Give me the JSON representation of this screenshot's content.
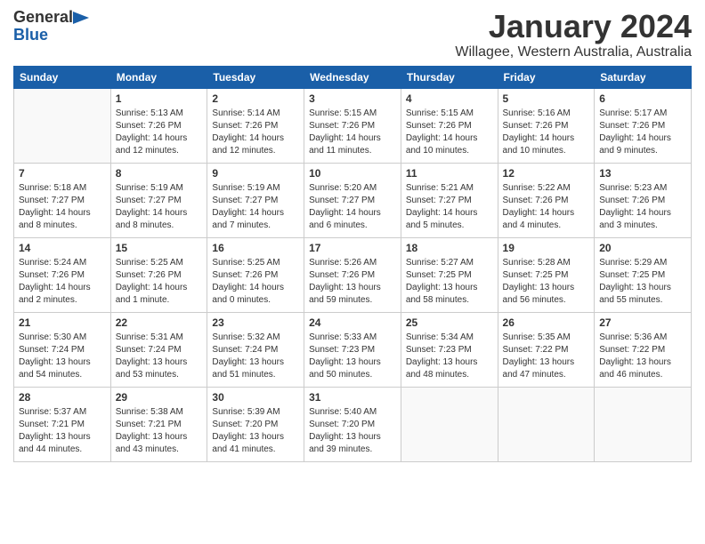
{
  "header": {
    "logo_line1": "General",
    "logo_line2": "Blue",
    "month_title": "January 2024",
    "location": "Willagee, Western Australia, Australia"
  },
  "weekdays": [
    "Sunday",
    "Monday",
    "Tuesday",
    "Wednesday",
    "Thursday",
    "Friday",
    "Saturday"
  ],
  "weeks": [
    [
      {
        "day": "",
        "info": ""
      },
      {
        "day": "1",
        "info": "Sunrise: 5:13 AM\nSunset: 7:26 PM\nDaylight: 14 hours\nand 12 minutes."
      },
      {
        "day": "2",
        "info": "Sunrise: 5:14 AM\nSunset: 7:26 PM\nDaylight: 14 hours\nand 12 minutes."
      },
      {
        "day": "3",
        "info": "Sunrise: 5:15 AM\nSunset: 7:26 PM\nDaylight: 14 hours\nand 11 minutes."
      },
      {
        "day": "4",
        "info": "Sunrise: 5:15 AM\nSunset: 7:26 PM\nDaylight: 14 hours\nand 10 minutes."
      },
      {
        "day": "5",
        "info": "Sunrise: 5:16 AM\nSunset: 7:26 PM\nDaylight: 14 hours\nand 10 minutes."
      },
      {
        "day": "6",
        "info": "Sunrise: 5:17 AM\nSunset: 7:26 PM\nDaylight: 14 hours\nand 9 minutes."
      }
    ],
    [
      {
        "day": "7",
        "info": "Sunrise: 5:18 AM\nSunset: 7:27 PM\nDaylight: 14 hours\nand 8 minutes."
      },
      {
        "day": "8",
        "info": "Sunrise: 5:19 AM\nSunset: 7:27 PM\nDaylight: 14 hours\nand 8 minutes."
      },
      {
        "day": "9",
        "info": "Sunrise: 5:19 AM\nSunset: 7:27 PM\nDaylight: 14 hours\nand 7 minutes."
      },
      {
        "day": "10",
        "info": "Sunrise: 5:20 AM\nSunset: 7:27 PM\nDaylight: 14 hours\nand 6 minutes."
      },
      {
        "day": "11",
        "info": "Sunrise: 5:21 AM\nSunset: 7:27 PM\nDaylight: 14 hours\nand 5 minutes."
      },
      {
        "day": "12",
        "info": "Sunrise: 5:22 AM\nSunset: 7:26 PM\nDaylight: 14 hours\nand 4 minutes."
      },
      {
        "day": "13",
        "info": "Sunrise: 5:23 AM\nSunset: 7:26 PM\nDaylight: 14 hours\nand 3 minutes."
      }
    ],
    [
      {
        "day": "14",
        "info": "Sunrise: 5:24 AM\nSunset: 7:26 PM\nDaylight: 14 hours\nand 2 minutes."
      },
      {
        "day": "15",
        "info": "Sunrise: 5:25 AM\nSunset: 7:26 PM\nDaylight: 14 hours\nand 1 minute."
      },
      {
        "day": "16",
        "info": "Sunrise: 5:25 AM\nSunset: 7:26 PM\nDaylight: 14 hours\nand 0 minutes."
      },
      {
        "day": "17",
        "info": "Sunrise: 5:26 AM\nSunset: 7:26 PM\nDaylight: 13 hours\nand 59 minutes."
      },
      {
        "day": "18",
        "info": "Sunrise: 5:27 AM\nSunset: 7:25 PM\nDaylight: 13 hours\nand 58 minutes."
      },
      {
        "day": "19",
        "info": "Sunrise: 5:28 AM\nSunset: 7:25 PM\nDaylight: 13 hours\nand 56 minutes."
      },
      {
        "day": "20",
        "info": "Sunrise: 5:29 AM\nSunset: 7:25 PM\nDaylight: 13 hours\nand 55 minutes."
      }
    ],
    [
      {
        "day": "21",
        "info": "Sunrise: 5:30 AM\nSunset: 7:24 PM\nDaylight: 13 hours\nand 54 minutes."
      },
      {
        "day": "22",
        "info": "Sunrise: 5:31 AM\nSunset: 7:24 PM\nDaylight: 13 hours\nand 53 minutes."
      },
      {
        "day": "23",
        "info": "Sunrise: 5:32 AM\nSunset: 7:24 PM\nDaylight: 13 hours\nand 51 minutes."
      },
      {
        "day": "24",
        "info": "Sunrise: 5:33 AM\nSunset: 7:23 PM\nDaylight: 13 hours\nand 50 minutes."
      },
      {
        "day": "25",
        "info": "Sunrise: 5:34 AM\nSunset: 7:23 PM\nDaylight: 13 hours\nand 48 minutes."
      },
      {
        "day": "26",
        "info": "Sunrise: 5:35 AM\nSunset: 7:22 PM\nDaylight: 13 hours\nand 47 minutes."
      },
      {
        "day": "27",
        "info": "Sunrise: 5:36 AM\nSunset: 7:22 PM\nDaylight: 13 hours\nand 46 minutes."
      }
    ],
    [
      {
        "day": "28",
        "info": "Sunrise: 5:37 AM\nSunset: 7:21 PM\nDaylight: 13 hours\nand 44 minutes."
      },
      {
        "day": "29",
        "info": "Sunrise: 5:38 AM\nSunset: 7:21 PM\nDaylight: 13 hours\nand 43 minutes."
      },
      {
        "day": "30",
        "info": "Sunrise: 5:39 AM\nSunset: 7:20 PM\nDaylight: 13 hours\nand 41 minutes."
      },
      {
        "day": "31",
        "info": "Sunrise: 5:40 AM\nSunset: 7:20 PM\nDaylight: 13 hours\nand 39 minutes."
      },
      {
        "day": "",
        "info": ""
      },
      {
        "day": "",
        "info": ""
      },
      {
        "day": "",
        "info": ""
      }
    ]
  ]
}
